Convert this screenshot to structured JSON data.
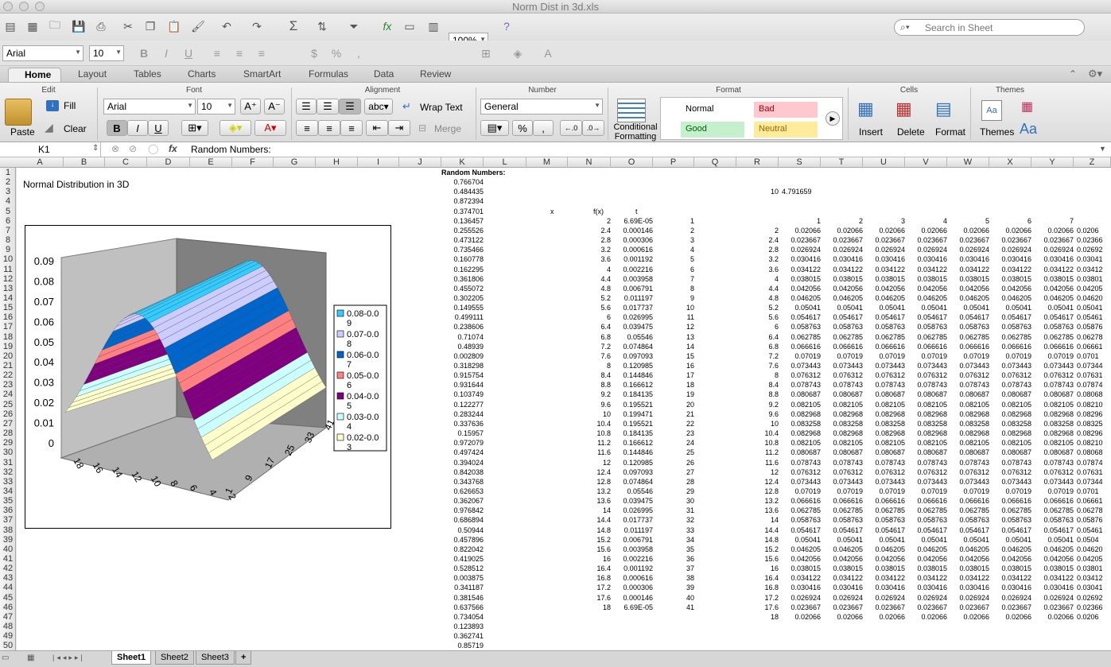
{
  "window": {
    "title": "Norm Dist in 3d.xls"
  },
  "toolbar": {
    "zoom": "100%",
    "search_placeholder": "Search in Sheet",
    "font": "Arial",
    "size": "10"
  },
  "ribbon": {
    "tabs": [
      "Home",
      "Layout",
      "Tables",
      "Charts",
      "SmartArt",
      "Formulas",
      "Data",
      "Review"
    ],
    "groups": [
      "Edit",
      "Font",
      "Alignment",
      "Number",
      "Format",
      "Cells",
      "Themes"
    ],
    "edit": {
      "fill": "Fill",
      "clear": "Clear",
      "paste": "Paste"
    },
    "font": {
      "name": "Arial",
      "size": "10"
    },
    "alignment": {
      "wrap": "Wrap Text",
      "merge": "Merge",
      "abc": "abc"
    },
    "number": {
      "format": "General"
    },
    "format": {
      "cond1": "Conditional",
      "cond2": "Formatting",
      "normal": "Normal",
      "bad": "Bad",
      "good": "Good",
      "neutral": "Neutral"
    },
    "cells": {
      "insert": "Insert",
      "delete": "Delete",
      "format": "Format"
    },
    "themes": {
      "themes": "Themes",
      "aa": "Aa"
    }
  },
  "formula_bar": {
    "cell": "K1",
    "content": "Random Numbers:"
  },
  "columns": [
    "A",
    "B",
    "C",
    "D",
    "E",
    "F",
    "G",
    "H",
    "I",
    "J",
    "K",
    "L",
    "M",
    "N",
    "O",
    "P",
    "Q",
    "R",
    "S",
    "T",
    "U",
    "V",
    "W",
    "X",
    "Y",
    "Z"
  ],
  "sheet": {
    "chart_title": "Normal Distribution in 3D",
    "k1": "Random Numbers:",
    "x_hdr": "x",
    "fx_hdr": "f(x)",
    "t_hdr": "t",
    "r3": "10",
    "s3": "4.791659",
    "random": [
      "0.766704",
      "0.484435",
      "0.872394",
      "0.374701",
      "0.136457",
      "0.255526",
      "0.473122",
      "0.735466",
      "0.160778",
      "0.162295",
      "0.361806",
      "0.455072",
      "0.302205",
      "0.149555",
      "0.499111",
      "0.238606",
      "0.71074",
      "0.48939",
      "0.002809",
      "0.318298",
      "0.915754",
      "0.931644",
      "0.103749",
      "0.122277",
      "0.283244",
      "0.337636",
      "0.15957",
      "0.972079",
      "0.497424",
      "0.394024",
      "0.842038",
      "0.343768",
      "0.626653",
      "0.362067",
      "0.976842",
      "0.686894",
      "0.50944",
      "0.457896",
      "0.822042",
      "0.419025",
      "0.528512",
      "0.003875",
      "0.341187",
      "0.381546",
      "0.637566",
      "0.734054",
      "0.123893",
      "0.362741",
      "0.85719"
    ],
    "x": [
      "2",
      "2.4",
      "2.8",
      "3.2",
      "3.6",
      "4",
      "4.4",
      "4.8",
      "5.2",
      "5.6",
      "6",
      "6.4",
      "6.8",
      "7.2",
      "7.6",
      "8",
      "8.4",
      "8.8",
      "9.2",
      "9.6",
      "10",
      "10.4",
      "10.8",
      "11.2",
      "11.6",
      "12",
      "12.4",
      "12.8",
      "13.2",
      "13.6",
      "14",
      "14.4",
      "14.8",
      "15.2",
      "15.6",
      "16",
      "16.4",
      "16.8",
      "17.2",
      "17.6",
      "18"
    ],
    "fx": [
      "6.69E-05",
      "0.000146",
      "0.000306",
      "0.000616",
      "0.001192",
      "0.002216",
      "0.003958",
      "0.006791",
      "0.011197",
      "0.017737",
      "0.026995",
      "0.039475",
      "0.05546",
      "0.074864",
      "0.097093",
      "0.120985",
      "0.144846",
      "0.166612",
      "0.184135",
      "0.195521",
      "0.199471",
      "0.195521",
      "0.184135",
      "0.166612",
      "0.144846",
      "0.120985",
      "0.097093",
      "0.074864",
      "0.05546",
      "0.039475",
      "0.026995",
      "0.017737",
      "0.011197",
      "0.006791",
      "0.003958",
      "0.002216",
      "0.001192",
      "0.000616",
      "0.000306",
      "0.000146",
      "6.69E-05"
    ],
    "t": [
      "1",
      "2",
      "3",
      "4",
      "5",
      "6",
      "7",
      "8",
      "9",
      "10",
      "11",
      "12",
      "13",
      "14",
      "15",
      "16",
      "17",
      "18",
      "19",
      "20",
      "21",
      "22",
      "23",
      "24",
      "25",
      "26",
      "27",
      "28",
      "29",
      "30",
      "31",
      "32",
      "33",
      "34",
      "35",
      "36",
      "37",
      "38",
      "39",
      "40",
      "41"
    ],
    "grid_hdr": [
      "1",
      "2",
      "3",
      "4",
      "5",
      "6",
      "7"
    ],
    "r_vals": [
      "2",
      "2.4",
      "2.8",
      "3.2",
      "3.6",
      "4",
      "4.4",
      "4.8",
      "5.2",
      "5.6",
      "6",
      "6.4",
      "6.8",
      "7.2",
      "7.6",
      "8",
      "8.4",
      "8.8",
      "9.2",
      "9.6",
      "10",
      "10.4",
      "10.8",
      "11.2",
      "11.6",
      "12",
      "12.4",
      "12.8",
      "13.2",
      "13.6",
      "14",
      "14.4",
      "14.8",
      "15.2",
      "15.6",
      "16",
      "16.4",
      "16.8",
      "17.2",
      "17.6",
      "18"
    ],
    "grid_vals": [
      "0.02066",
      "0.023667",
      "0.026924",
      "0.030416",
      "0.034122",
      "0.038015",
      "0.042056",
      "0.046205",
      "0.05041",
      "0.054617",
      "0.058763",
      "0.062785",
      "0.066616",
      "0.07019",
      "0.073443",
      "0.076312",
      "0.078743",
      "0.080687",
      "0.082105",
      "0.082968",
      "0.083258",
      "0.082968",
      "0.082105",
      "0.080687",
      "0.078743",
      "0.076312",
      "0.073443",
      "0.07019",
      "0.066616",
      "0.062785",
      "0.058763",
      "0.054617",
      "0.05041",
      "0.046205",
      "0.042056",
      "0.038015",
      "0.034122",
      "0.030416",
      "0.026924",
      "0.023667",
      "0.02066"
    ],
    "z_clip": [
      "0.0206",
      "0.02366",
      "0.02692",
      "0.03041",
      "0.03412",
      "0.03801",
      "0.04205",
      "0.04620",
      "0.05041",
      "0.05461",
      "0.05876",
      "0.06278",
      "0.06661",
      "0.0701",
      "0.07344",
      "0.07631",
      "0.07874",
      "0.08068",
      "0.08210",
      "0.08296",
      "0.08325",
      "0.08296",
      "0.08210",
      "0.08068",
      "0.07874",
      "0.07631",
      "0.07344",
      "0.0701",
      "0.06661",
      "0.06278",
      "0.05876",
      "0.05461",
      "0.0504",
      "0.04620",
      "0.04205",
      "0.03801",
      "0.03412",
      "0.03041",
      "0.02692",
      "0.02366",
      "0.0206"
    ]
  },
  "chart": {
    "y_ticks": [
      "0.09",
      "0.08",
      "0.07",
      "0.06",
      "0.05",
      "0.04",
      "0.03",
      "0.02",
      "0.01",
      "0"
    ],
    "x_ticks": [
      "18",
      "16",
      "14",
      "12",
      "10",
      "8",
      "6",
      "4",
      "2"
    ],
    "z_ticks": [
      "1",
      "9",
      "17",
      "25",
      "33",
      "41"
    ],
    "legend": [
      {
        "a": "0.08-0.0",
        "b": "9",
        "color": "#33ccff"
      },
      {
        "a": "0.07-0.0",
        "b": "8",
        "color": "#ccccff"
      },
      {
        "a": "0.06-0.0",
        "b": "7",
        "color": "#0066cc"
      },
      {
        "a": "0.05-0.0",
        "b": "6",
        "color": "#ff8080"
      },
      {
        "a": "0.04-0.0",
        "b": "5",
        "color": "#800080"
      },
      {
        "a": "0.03-0.0",
        "b": "4",
        "color": "#ccffff"
      },
      {
        "a": "0.02-0.0",
        "b": "3",
        "color": "#ffffcc"
      }
    ]
  },
  "sheet_tabs": [
    "Sheet1",
    "Sheet2",
    "Sheet3"
  ],
  "chart_data": {
    "type": "surface",
    "title": "Normal Distribution in 3D",
    "ylim": [
      0,
      0.09
    ],
    "x_ticks": [
      "18",
      "16",
      "14",
      "12",
      "10",
      "8",
      "6",
      "4",
      "2"
    ],
    "z_ticks": [
      "1",
      "9",
      "17",
      "25",
      "33",
      "41"
    ],
    "profile": [
      0.02066,
      0.023667,
      0.026924,
      0.030416,
      0.034122,
      0.038015,
      0.042056,
      0.046205,
      0.05041,
      0.054617,
      0.058763,
      0.062785,
      0.066616,
      0.07019,
      0.073443,
      0.076312,
      0.078743,
      0.080687,
      0.082105,
      0.082968,
      0.083258,
      0.082968,
      0.082105,
      0.080687,
      0.078743,
      0.076312,
      0.073443,
      0.07019,
      0.066616,
      0.062785,
      0.058763,
      0.054617,
      0.05041,
      0.046205,
      0.042056,
      0.038015,
      0.034122,
      0.030416,
      0.026924,
      0.023667,
      0.02066
    ],
    "legend": [
      "0.08-0.09",
      "0.07-0.08",
      "0.06-0.07",
      "0.05-0.06",
      "0.04-0.05",
      "0.03-0.04",
      "0.02-0.03"
    ]
  }
}
